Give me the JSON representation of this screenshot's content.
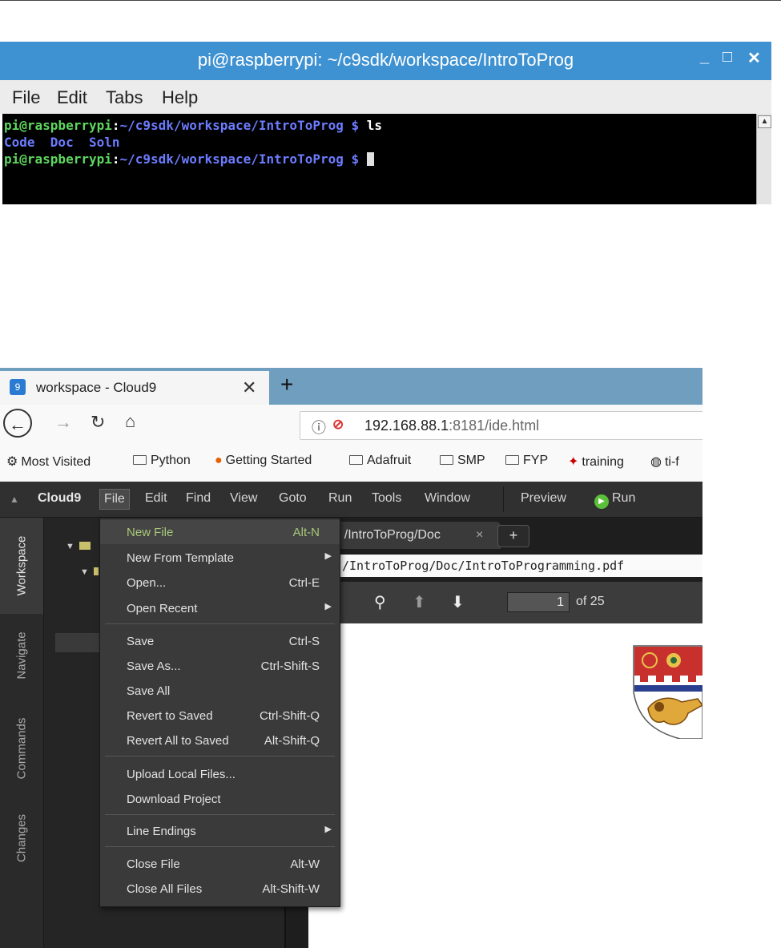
{
  "terminal": {
    "title": "pi@raspberrypi: ~/c9sdk/workspace/IntroToProg",
    "controls": {
      "minimize": "_",
      "maximize": "□",
      "close": "✕"
    },
    "menu": [
      "File",
      "Edit",
      "Tabs",
      "Help"
    ],
    "line1": {
      "user": "pi@raspberrypi",
      "sep": ":",
      "path": "~/c9sdk/workspace/IntroToProg $",
      "cmd": " ls"
    },
    "line2": [
      "Code",
      "Doc",
      "Soln"
    ],
    "line3": {
      "user": "pi@raspberrypi",
      "sep": ":",
      "path": "~/c9sdk/workspace/IntroToProg $"
    }
  },
  "browser": {
    "tab_title": "workspace - Cloud9",
    "tab_close": "✕",
    "new_tab": "+",
    "url_host": "192.168.88.1",
    "url_rest": ":8181/ide.html",
    "bookmarks": [
      "Most Visited",
      "Python",
      "Getting Started",
      "Adafruit",
      "SMP",
      "FYP",
      "training",
      "ti-f"
    ]
  },
  "ide": {
    "menu": [
      "Cloud9",
      "File",
      "Edit",
      "Find",
      "View",
      "Goto",
      "Run",
      "Tools",
      "Window",
      "Preview",
      "Run"
    ],
    "side_tabs": [
      "Workspace",
      "Navigate",
      "Commands",
      "Changes"
    ],
    "editor_tab": "3] /IntroToProg/Doc",
    "editor_tab_close": "×",
    "editor_plus": "+",
    "path": "/IntroToProg/Doc/IntroToProgramming.pdf",
    "page_current": "1",
    "page_total": "of 25"
  },
  "file_menu": {
    "items": [
      {
        "label": "New File",
        "shortcut": "Alt-N"
      },
      {
        "label": "New From Template",
        "shortcut": ""
      },
      {
        "label": "Open...",
        "shortcut": "Ctrl-E"
      },
      {
        "label": "Open Recent",
        "shortcut": ""
      },
      {
        "label": "Save",
        "shortcut": "Ctrl-S"
      },
      {
        "label": "Save As...",
        "shortcut": "Ctrl-Shift-S"
      },
      {
        "label": "Save All",
        "shortcut": ""
      },
      {
        "label": "Revert to Saved",
        "shortcut": "Ctrl-Shift-Q"
      },
      {
        "label": "Revert All to Saved",
        "shortcut": "Alt-Shift-Q"
      },
      {
        "label": "Upload Local Files...",
        "shortcut": ""
      },
      {
        "label": "Download Project",
        "shortcut": ""
      },
      {
        "label": "Line Endings",
        "shortcut": ""
      },
      {
        "label": "Close File",
        "shortcut": "Alt-W"
      },
      {
        "label": "Close All Files",
        "shortcut": "Alt-Shift-W"
      }
    ]
  },
  "colors": {
    "terminal_title_bar": "#3f92d2",
    "prompt_user": "#5fd75f",
    "prompt_path": "#6c7cff",
    "menu_highlight_text": "#a8c878",
    "run_icon": "#5bbf3a"
  }
}
